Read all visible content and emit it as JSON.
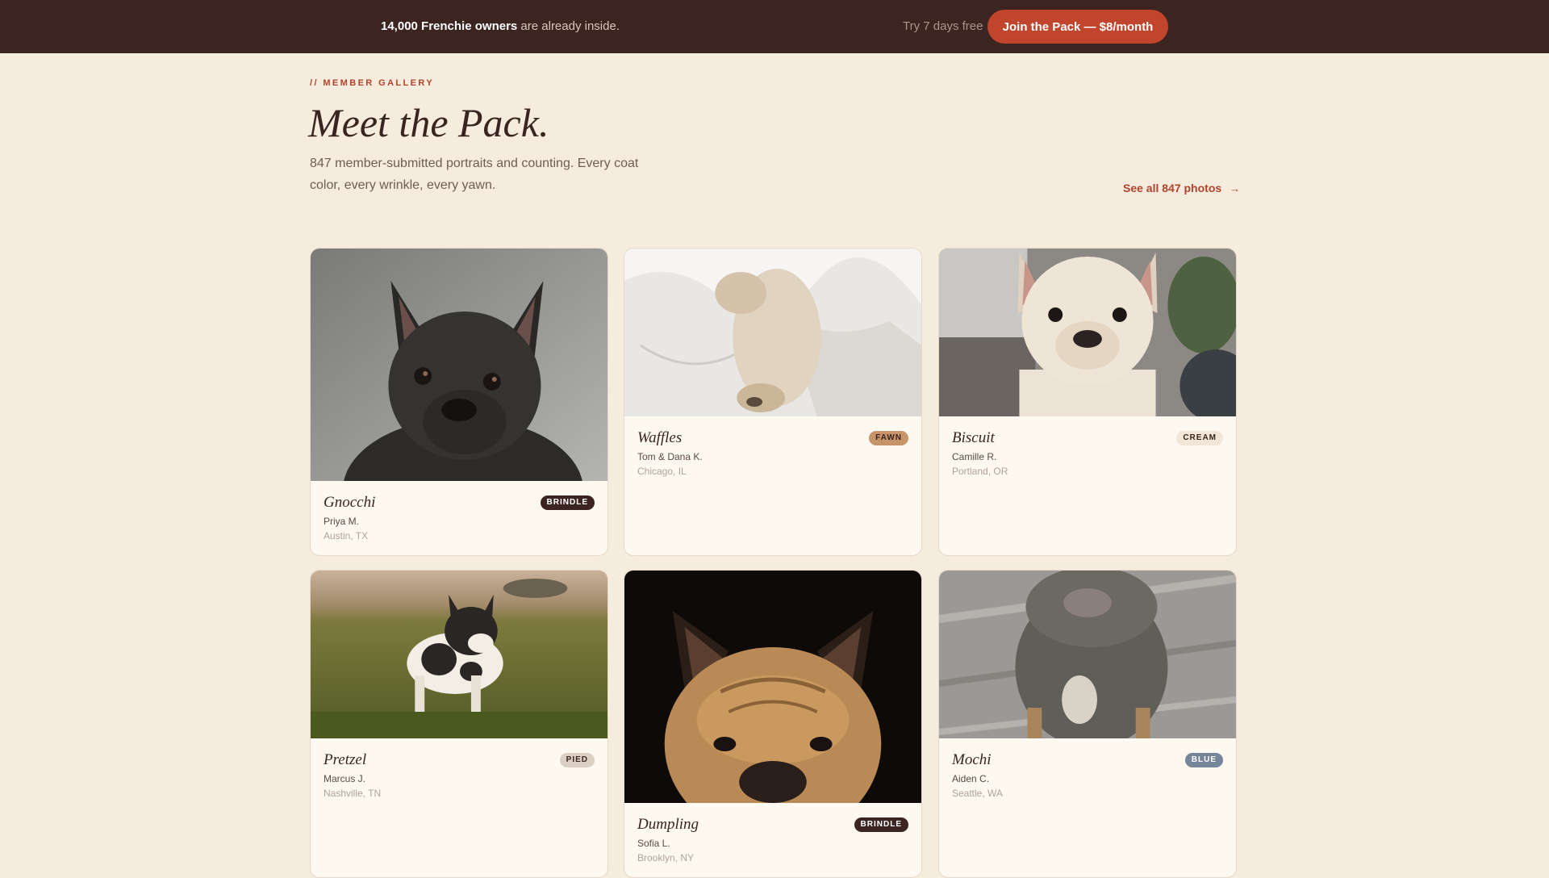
{
  "topbar": {
    "promo_strong": "14,000 Frenchie owners",
    "promo_rest": " are already inside.",
    "trial": "Try 7 days free",
    "cta": "Join the Pack — $8/month"
  },
  "header": {
    "eyebrow": "// MEMBER GALLERY",
    "title": "Meet the Pack.",
    "description": "847 member-submitted portraits and counting. Every coat color, every wrinkle, every yawn.",
    "see_all": "See all 847 photos",
    "see_all_arrow": "→"
  },
  "cards": [
    {
      "name": "Gnocchi",
      "badge": "BRINDLE",
      "owner": "Priya M.",
      "city": "Austin, TX"
    },
    {
      "name": "Waffles",
      "badge": "FAWN",
      "owner": "Tom & Dana K.",
      "city": "Chicago, IL"
    },
    {
      "name": "Biscuit",
      "badge": "CREAM",
      "owner": "Camille R.",
      "city": "Portland, OR"
    },
    {
      "name": "Pretzel",
      "badge": "PIED",
      "owner": "Marcus J.",
      "city": "Nashville, TN"
    },
    {
      "name": "Dumpling",
      "badge": "BRINDLE",
      "owner": "Sofia L.",
      "city": "Brooklyn, NY"
    },
    {
      "name": "Mochi",
      "badge": "BLUE",
      "owner": "Aiden C.",
      "city": "Seattle, WA"
    }
  ],
  "colors": {
    "topbar_bg": "#3c2420",
    "page_bg": "#f5ecde",
    "accent": "#c0452c",
    "text_dark": "#3a2420"
  }
}
